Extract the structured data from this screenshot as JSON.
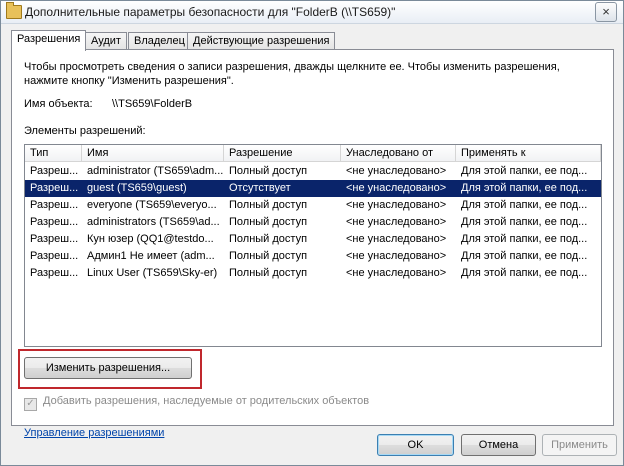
{
  "window": {
    "title": "Дополнительные параметры безопасности  для \"FolderB (\\\\TS659)\"",
    "close_icon": "×"
  },
  "tabs": [
    {
      "label": "Разрешения"
    },
    {
      "label": "Аудит"
    },
    {
      "label": "Владелец"
    },
    {
      "label": "Действующие разрешения"
    }
  ],
  "panel": {
    "description": "Чтобы просмотреть сведения о записи разрешения, дважды щелкните ее. Чтобы изменить разрешения, нажмите кнопку \"Изменить разрешения\".",
    "object_label": "Имя объекта:",
    "object_value": "\\\\TS659\\FolderB",
    "elements_label": "Элементы разрешений:"
  },
  "table": {
    "columns": [
      "Тип",
      "Имя",
      "Разрешение",
      "Унаследовано от",
      "Применять к"
    ],
    "rows": [
      [
        "Разреш...",
        "administrator (TS659\\adm...",
        "Полный доступ",
        "<не унаследовано>",
        "Для этой папки, ее под..."
      ],
      [
        "Разреш...",
        "guest (TS659\\guest)",
        "Отсутствует",
        "<не унаследовано>",
        "Для этой папки, ее под..."
      ],
      [
        "Разреш...",
        "everyone (TS659\\everyo...",
        "Полный доступ",
        "<не унаследовано>",
        "Для этой папки, ее под..."
      ],
      [
        "Разреш...",
        "administrators (TS659\\ad...",
        "Полный доступ",
        "<не унаследовано>",
        "Для этой папки, ее под..."
      ],
      [
        "Разреш...",
        "Кун юзер (QQ1@testdo...",
        "Полный доступ",
        "<не унаследовано>",
        "Для этой папки, ее под..."
      ],
      [
        "Разреш...",
        "Админ1 Не имеет (adm...",
        "Полный доступ",
        "<не унаследовано>",
        "Для этой папки, ее под..."
      ],
      [
        "Разреш...",
        "Linux User (TS659\\Sky-er)",
        "Полный доступ",
        "<не унаследовано>",
        "Для этой папки, ее под..."
      ]
    ],
    "selected_row": 1
  },
  "buttons": {
    "change_permissions": "Изменить разрешения...",
    "ok": "OK",
    "cancel": "Отмена",
    "apply": "Применить"
  },
  "inherit_checkbox": {
    "label": "Добавить разрешения, наследуемые от родительских объектов",
    "checked": true,
    "check_glyph": "✓"
  },
  "manage_link": "Управление разрешениями",
  "colors": {
    "selection": "#0a246a",
    "highlight_border": "#c0282d",
    "link": "#0044aa"
  }
}
